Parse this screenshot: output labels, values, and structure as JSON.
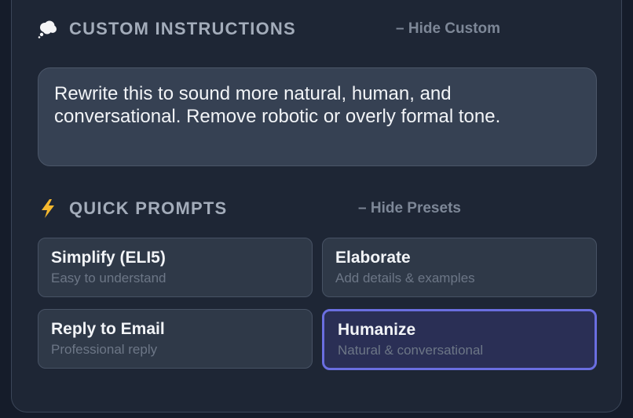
{
  "custom_instructions": {
    "title": "CUSTOM INSTRUCTIONS",
    "icon": "thought-bubble-icon",
    "toggle_label": "– Hide Custom",
    "text": "Rewrite this to sound more natural, human, and conversational. Remove robotic or overly formal tone."
  },
  "quick_prompts": {
    "title": "QUICK PROMPTS",
    "icon": "lightning-icon",
    "toggle_label": "– Hide Presets",
    "items": [
      {
        "title": "Simplify (ELI5)",
        "subtitle": "Easy to understand",
        "selected": false
      },
      {
        "title": "Elaborate",
        "subtitle": "Add details & examples",
        "selected": false
      },
      {
        "title": "Reply to Email",
        "subtitle": "Professional reply",
        "selected": false
      },
      {
        "title": "Humanize",
        "subtitle": "Natural & conversational",
        "selected": true
      }
    ]
  },
  "colors": {
    "background": "#151c2a",
    "panel": "#1e2635",
    "accent": "#6a6ee0",
    "lightning": "#f5b82e"
  }
}
